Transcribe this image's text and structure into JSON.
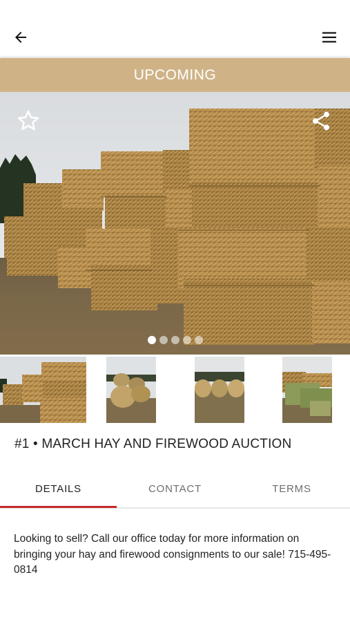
{
  "topbar": {
    "back_icon": "arrow-left-icon",
    "menu_icon": "hamburger-menu-icon"
  },
  "status_banner": {
    "label": "UPCOMING",
    "color": "#cfb387"
  },
  "hero": {
    "image": "hay-bales-photo",
    "favorite_icon": "star-outline-icon",
    "share_icon": "share-icon",
    "slide_count": 5,
    "active_slide": 1
  },
  "thumbnails": [
    "square-bales-thumbnail",
    "round-bales-thumbnail",
    "round-bales-field-thumbnail",
    "green-bales-thumbnail"
  ],
  "listing": {
    "title": "#1 • MARCH HAY AND FIREWOOD AUCTION"
  },
  "tabs": [
    {
      "label": "DETAILS",
      "active": true
    },
    {
      "label": "CONTACT",
      "active": false
    },
    {
      "label": "TERMS",
      "active": false
    }
  ],
  "details": {
    "description": "Looking to sell? Call our office today for more information on bringing your hay and firewood consignments to our sale! 715-495-0814"
  },
  "colors": {
    "accent": "#c62828",
    "banner": "#cfb387"
  }
}
